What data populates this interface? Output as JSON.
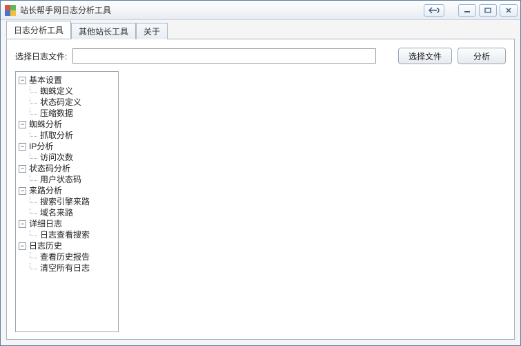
{
  "window": {
    "title": "站长帮手网日志分析工具"
  },
  "tabs": [
    {
      "label": "日志分析工具",
      "active": true
    },
    {
      "label": "其他站长工具",
      "active": false
    },
    {
      "label": "关于",
      "active": false
    }
  ],
  "filebar": {
    "label": "选择日志文件:",
    "value": "",
    "placeholder": "",
    "choose_btn": "选择文件",
    "analyze_btn": "分析"
  },
  "tree": [
    {
      "label": "基本设置",
      "expanded": true,
      "children": [
        "蜘蛛定义",
        "状态码定义",
        "压缩数据"
      ]
    },
    {
      "label": "蜘蛛分析",
      "expanded": true,
      "children": [
        "抓取分析"
      ]
    },
    {
      "label": "IP分析",
      "expanded": true,
      "children": [
        "访问次数"
      ]
    },
    {
      "label": "状态码分析",
      "expanded": true,
      "children": [
        "用户状态码"
      ]
    },
    {
      "label": "来路分析",
      "expanded": true,
      "children": [
        "搜索引擎来路",
        "域名来路"
      ]
    },
    {
      "label": "详细日志",
      "expanded": true,
      "children": [
        "日志查看搜索"
      ]
    },
    {
      "label": "日志历史",
      "expanded": true,
      "children": [
        "查看历史报告",
        "清空所有日志"
      ]
    }
  ],
  "titlebar_icons": {
    "back": "back-icon",
    "min": "minimize-icon",
    "max": "maximize-icon",
    "close": "close-icon"
  }
}
